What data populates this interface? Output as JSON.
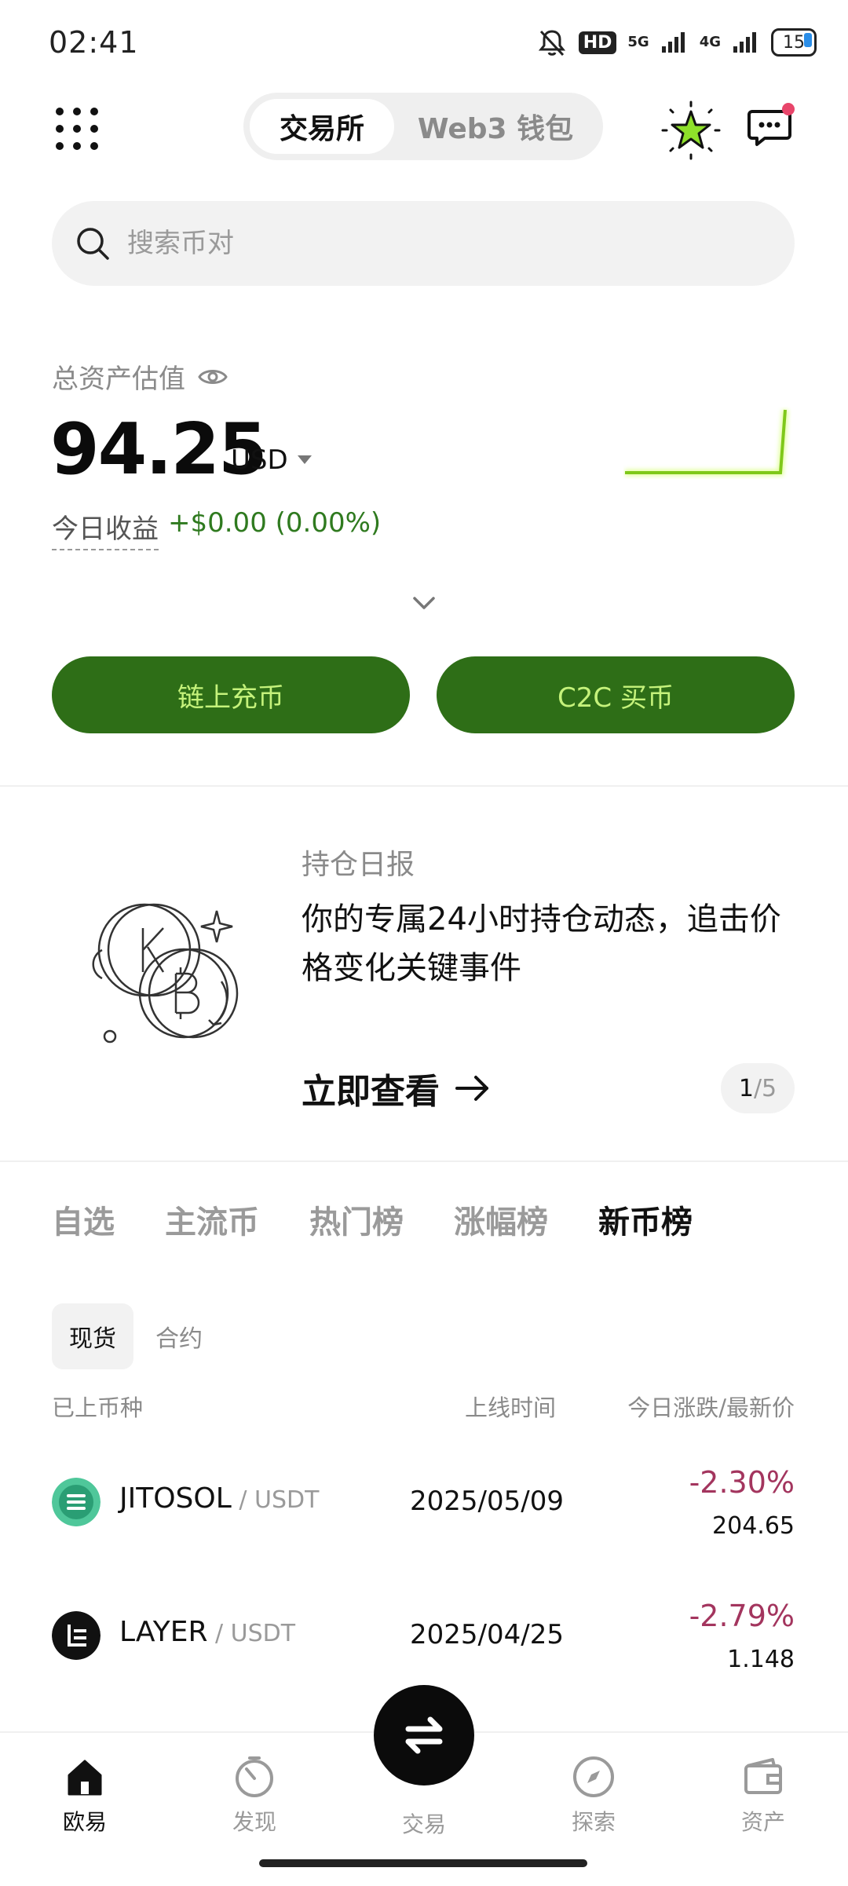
{
  "status_bar": {
    "time": "02:41",
    "hd_badge": "HD",
    "network_5g": "5G",
    "network_4g": "4G",
    "battery": "15"
  },
  "header": {
    "tabs": [
      "交易所",
      "Web3 钱包"
    ],
    "active_tab": 0
  },
  "search": {
    "placeholder": "搜索币对"
  },
  "assets": {
    "label": "总资产估值",
    "value": "94.25",
    "currency": "USD",
    "profit_label": "今日收益",
    "profit_value": "+$0.00 (0.00%)"
  },
  "actions": {
    "deposit_label": "链上充币",
    "c2c_label": "C2C 买币"
  },
  "promo": {
    "subtitle": "持仓日报",
    "title": "你的专属24小时持仓动态，追击价格变化关键事件",
    "cta": "立即查看",
    "page_current": "1",
    "page_total": "/5"
  },
  "market": {
    "tabs": [
      "自选",
      "主流币",
      "热门榜",
      "涨幅榜",
      "新币榜"
    ],
    "active_tab": 4,
    "sub_tabs": [
      "现货",
      "合约"
    ],
    "columns": {
      "col1": "已上币种",
      "col2": "上线时间",
      "col3": "今日涨跌/最新价"
    },
    "rows": [
      {
        "symbol": "JITOSOL",
        "quote": " / USDT",
        "date": "2025/05/09",
        "change": "-2.30%",
        "price": "204.65"
      },
      {
        "symbol": "LAYER",
        "quote": " / USDT",
        "date": "2025/04/25",
        "change": "-2.79%",
        "price": "1.148"
      }
    ]
  },
  "bottom_nav": {
    "items": [
      "欧易",
      "发现",
      "交易",
      "探索",
      "资产"
    ],
    "active": 0
  },
  "colors": {
    "accent_green": "#2e6e17",
    "button_text": "#c5f27b",
    "negative": "#a3355e"
  }
}
